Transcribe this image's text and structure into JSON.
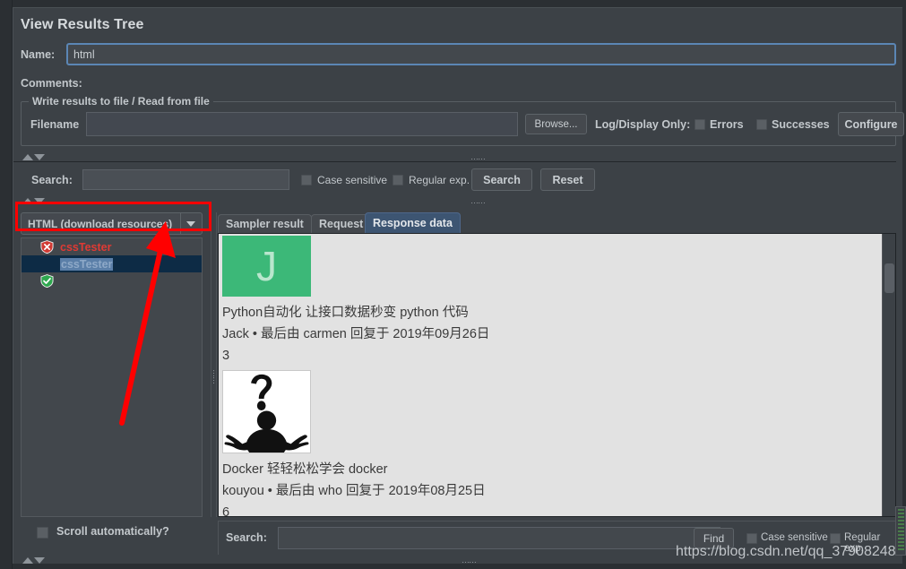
{
  "window": {
    "title": "View Results Tree"
  },
  "fields": {
    "name_label": "Name:",
    "name_value": "html",
    "comments_label": "Comments:",
    "comments_value": ""
  },
  "file_group": {
    "legend": "Write results to file / Read from file",
    "filename_label": "Filename",
    "filename_value": "",
    "browse_label": "Browse...",
    "logdisplay_label": "Log/Display Only:",
    "errors_label": "Errors",
    "successes_label": "Successes",
    "configure_label": "Configure"
  },
  "search_panel": {
    "label": "Search:",
    "value": "",
    "case_sensitive_label": "Case sensitive",
    "regular_exp_label": "Regular exp.",
    "search_button": "Search",
    "reset_button": "Reset"
  },
  "renderer": {
    "selected": "HTML (download resources)"
  },
  "tree": {
    "items": [
      {
        "label": "cssTester",
        "status": "fail",
        "icon": "shield-x-icon",
        "selected": false
      },
      {
        "label": "cssTester",
        "status": "pass",
        "icon": "shield-check-icon",
        "selected": true
      }
    ],
    "scroll_automatically_label": "Scroll automatically?"
  },
  "tabs": [
    {
      "label": "Sampler result",
      "active": false
    },
    {
      "label": "Request",
      "active": false
    },
    {
      "label": "Response data",
      "active": true
    }
  ],
  "response_content": {
    "posts": [
      {
        "avatar_type": "letter",
        "avatar_letter": "J",
        "avatar_color": "#3cb878",
        "title": "Python自动化 让接口数据秒变 python 代码",
        "meta": "Jack • 最后由 carmen 回复于 2019年09月26日",
        "count": "3"
      },
      {
        "avatar_type": "image",
        "avatar_alt": "shrug-silhouette-icon",
        "title": "Docker 轻轻松松学会 docker",
        "meta": "kouyou • 最后由 who 回复于 2019年08月25日",
        "count": "6"
      }
    ]
  },
  "bottom_search": {
    "label": "Search:",
    "value": "",
    "find_button": "Find",
    "case_sensitive_label": "Case sensitive",
    "regular_exp_label": "Regular exp."
  },
  "watermark": {
    "text": "https://blog.csdn.net/qq_37908248"
  },
  "colors": {
    "accent_blue": "#5b86b5",
    "tab_active": "#3d5572",
    "fail_red": "#e03a34",
    "pass_green": "#3cb878",
    "annotation_red": "#ff0000",
    "panel_bg": "#3c4146",
    "content_bg": "#e2e2e2"
  }
}
